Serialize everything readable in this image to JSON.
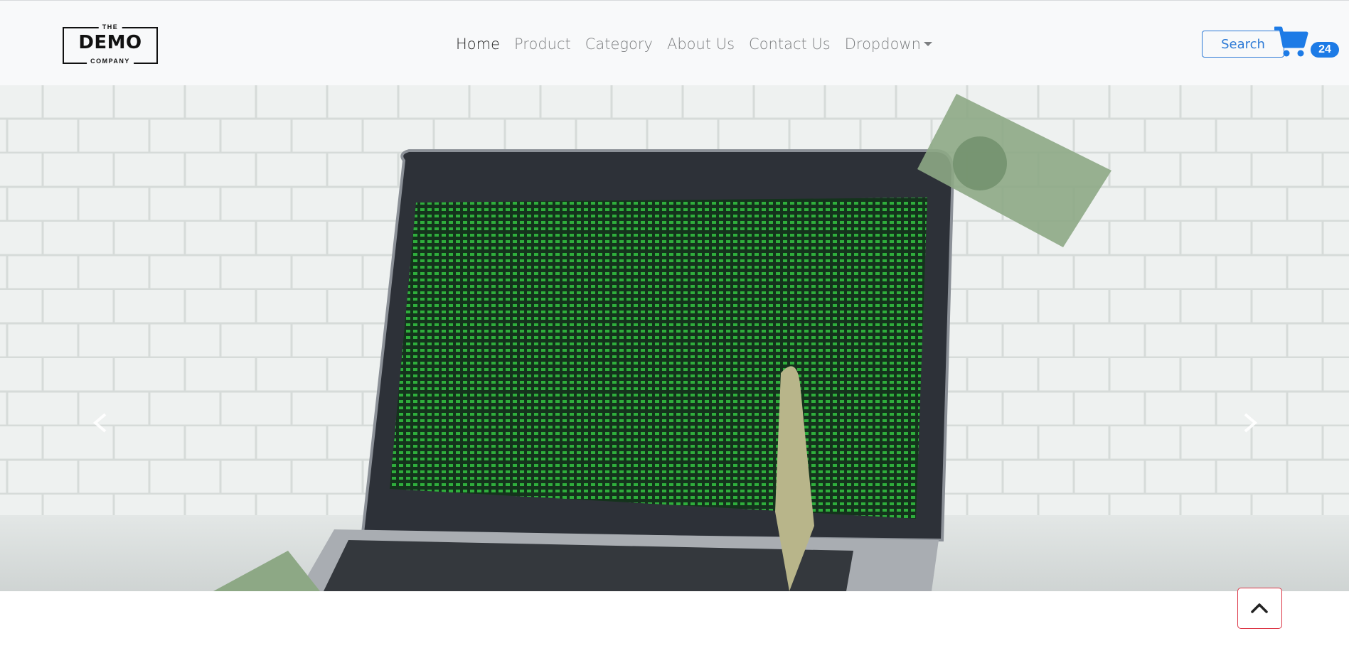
{
  "brand": {
    "top": "THE",
    "main": "DEMO",
    "bottom": "COMPANY"
  },
  "nav": {
    "items": [
      {
        "label": "Home"
      },
      {
        "label": "Product"
      },
      {
        "label": "Category"
      },
      {
        "label": "About Us"
      },
      {
        "label": "Contact Us"
      },
      {
        "label": "Dropdown"
      }
    ]
  },
  "search": {
    "label": "Search"
  },
  "cart": {
    "count": "24",
    "icon": "cart-icon"
  },
  "carousel": {
    "prev_icon": "chevron-left-icon",
    "next_icon": "chevron-right-icon",
    "slide_description_icon": "laptop-money-image"
  },
  "scroll_top": {
    "icon": "chevron-up-icon"
  },
  "colors": {
    "navbar_bg": "#f8f9fa",
    "link": "#7d7f81",
    "active_link": "#222222",
    "primary": "#1d7be6",
    "danger": "#dc3545"
  }
}
